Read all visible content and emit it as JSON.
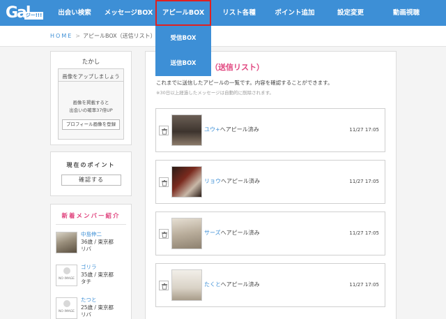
{
  "header": {
    "logo_big": "Gal",
    "logo_small": "ジー!!!",
    "nav": [
      {
        "label": "出会い検索",
        "active": false
      },
      {
        "label": "メッセージBOX",
        "active": false
      },
      {
        "label": "アピールBOX",
        "active": true
      },
      {
        "label": "リスト各種",
        "active": false
      },
      {
        "label": "ポイント追加",
        "active": false
      },
      {
        "label": "設定変更",
        "active": false
      },
      {
        "label": "動画視聴",
        "active": false
      }
    ],
    "dropdown": [
      "受信BOX",
      "送信BOX"
    ]
  },
  "breadcrumb": {
    "home": "HOME",
    "sep": ">",
    "current": "アピールBOX（送信リスト）"
  },
  "sidebar": {
    "username": "たかし",
    "upload_title": "画像をアップしましょう",
    "upload_text1": "画像を掲載すると",
    "upload_text2": "出会いの確率37倍UP",
    "upload_button": "プロフィール画像を登録",
    "points_title": "現在のポイント",
    "points_button": "確認する",
    "new_members_title": "新着メンバー紹介",
    "no_image_label": "NO IMAGE",
    "members": [
      {
        "name": "中島伸二",
        "info": "36歳 / 東京都",
        "tag": "リバ",
        "has_photo": true
      },
      {
        "name": "ゴリラ",
        "info": "35歳 / 東京都",
        "tag": "タチ",
        "has_photo": false
      },
      {
        "name": "たつと",
        "info": "25歳 / 東京都",
        "tag": "リバ",
        "has_photo": false
      }
    ]
  },
  "main": {
    "title": "（送信リスト）",
    "description": "これまでに送信したアピールの一覧です。内容を確認することができます。",
    "note": "※30日以上経過したメッセージは自動的に削除されます。",
    "appeals": [
      {
        "name": "ユウ+",
        "action": "へアピール済み",
        "time": "11/27 17:05"
      },
      {
        "name": "リョウ",
        "action": "へアピール済み",
        "time": "11/27 17:05"
      },
      {
        "name": "サーズ",
        "action": "へアピール済み",
        "time": "11/27 17:05"
      },
      {
        "name": "たくと",
        "action": "へアピール済み",
        "time": "11/27 17:05"
      }
    ]
  }
}
